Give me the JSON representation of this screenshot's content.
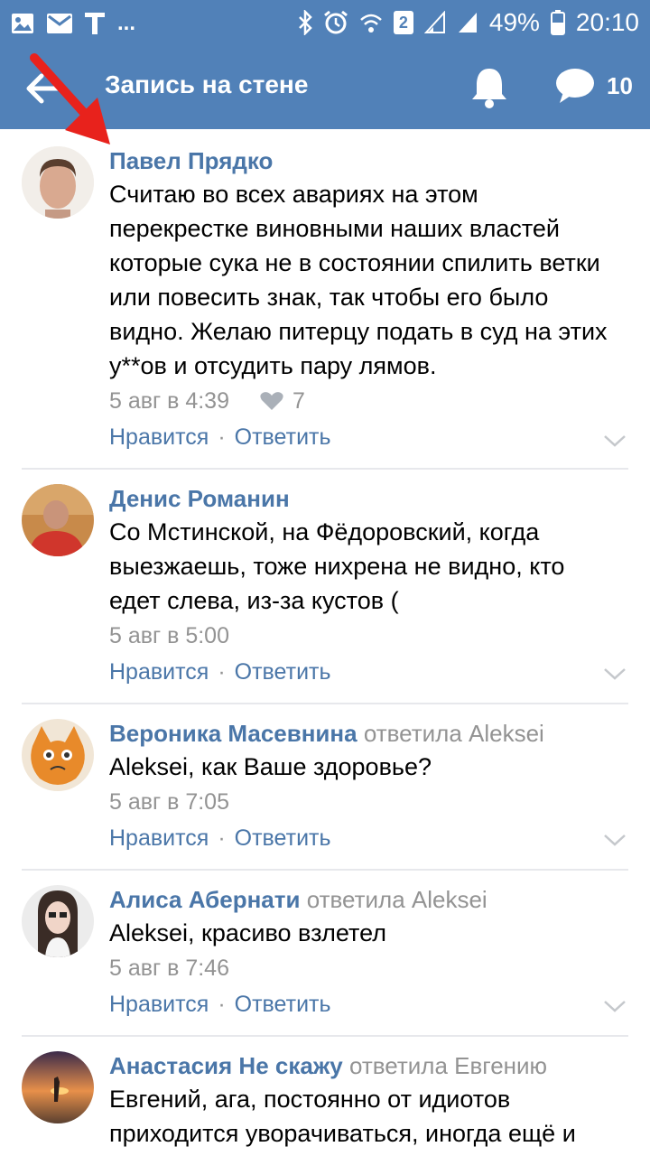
{
  "status_bar": {
    "battery": "49%",
    "time": "20:10",
    "sim": "2",
    "icons": [
      "image-icon",
      "mail-icon",
      "text-icon",
      "more-icon",
      "bluetooth-icon",
      "alarm-icon",
      "wifi-icon",
      "sim-icon",
      "signal-icon",
      "signal-icon",
      "battery-icon"
    ],
    "ellipsis": "..."
  },
  "toolbar": {
    "title": "Запись на стене",
    "messages_count": "10"
  },
  "colors": {
    "header": "#5181b8",
    "link": "#4a76a8",
    "muted": "#939393",
    "annotation": "#e8221c"
  },
  "comments": [
    {
      "author": "Павел Прядко",
      "replied_to": "",
      "text_lines": [
        "Считаю во всех авариях на этом",
        "перекрестке виновными наших властей",
        "которые сука не в состоянии спилить ветки",
        "или повесить знак, так чтобы его было",
        "видно. Желаю питерцу подать в суд на этих",
        "у**ов и отсудить пару лямов."
      ],
      "date": "5 авг в 4:39",
      "likes": "7",
      "like_label": "Нравится",
      "reply_label": "Ответить"
    },
    {
      "author": "Денис Романин",
      "replied_to": "",
      "text_lines": [
        "Со Мстинской, на Фёдоровский, когда",
        "выезжаешь, тоже нихрена не видно, кто",
        "едет слева, из-за кустов ("
      ],
      "date": "5 авг в 5:00",
      "like_label": "Нравится",
      "reply_label": "Ответить"
    },
    {
      "author": "Вероника Масевнина",
      "replied_to": "ответила Aleksei",
      "text_lines": [
        "Aleksei, как Ваше здоровье?"
      ],
      "date": "5 авг в 7:05",
      "like_label": "Нравится",
      "reply_label": "Ответить"
    },
    {
      "author": "Алиса Абернати",
      "replied_to": "ответила Aleksei",
      "text_lines": [
        "Aleksei, красиво взлетел"
      ],
      "date": "5 авг в 7:46",
      "like_label": "Нравится",
      "reply_label": "Ответить"
    },
    {
      "author": "Анастасия Не скажу",
      "replied_to": "ответила Евгению",
      "text_lines": [
        "Евгений, ага, постоянно от идиотов",
        "приходится уворачиваться, иногда ещё и"
      ],
      "date": "",
      "like_label": "",
      "reply_label": ""
    }
  ]
}
